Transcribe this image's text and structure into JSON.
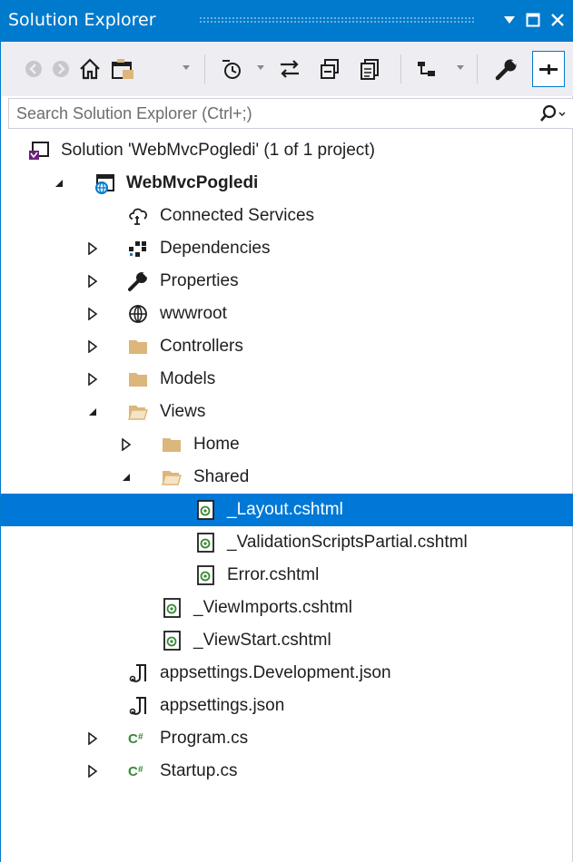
{
  "window": {
    "title": "Solution Explorer"
  },
  "titlebar_buttons": [
    {
      "name": "dropdown-arrow",
      "glyph": "▼"
    },
    {
      "name": "maximize",
      "glyph": "□"
    },
    {
      "name": "close",
      "glyph": "✕"
    }
  ],
  "toolbar": {
    "tools": [
      "back",
      "forward",
      "home",
      "switch-views",
      "pending-changes-filter",
      "sync-with-active-document",
      "collapse-all",
      "show-all-files",
      "preview-selected-items",
      "properties",
      "pin"
    ]
  },
  "search": {
    "placeholder": "Search Solution Explorer (Ctrl+;)"
  },
  "tree": {
    "items": [
      {
        "label": "Solution 'WebMvcPogledi' (1 of 1 project)",
        "icon": "solution-icon",
        "state": "none",
        "selected": false,
        "bold": false
      },
      {
        "label": "WebMvcPogledi",
        "icon": "web-project-icon",
        "state": "expanded",
        "selected": false,
        "bold": true
      },
      {
        "label": "Connected Services",
        "icon": "connected-services-icon",
        "state": "none",
        "selected": false,
        "bold": false
      },
      {
        "label": "Dependencies",
        "icon": "dependencies-icon",
        "state": "collapsed",
        "selected": false,
        "bold": false
      },
      {
        "label": "Properties",
        "icon": "wrench-icon",
        "state": "collapsed",
        "selected": false,
        "bold": false
      },
      {
        "label": "wwwroot",
        "icon": "globe-icon",
        "state": "collapsed",
        "selected": false,
        "bold": false
      },
      {
        "label": "Controllers",
        "icon": "folder-icon",
        "state": "collapsed",
        "selected": false,
        "bold": false
      },
      {
        "label": "Models",
        "icon": "folder-icon",
        "state": "collapsed",
        "selected": false,
        "bold": false
      },
      {
        "label": "Views",
        "icon": "folder-open-icon",
        "state": "expanded",
        "selected": false,
        "bold": false
      },
      {
        "label": "Home",
        "icon": "folder-icon",
        "state": "collapsed",
        "selected": false,
        "bold": false
      },
      {
        "label": "Shared",
        "icon": "folder-open-icon",
        "state": "expanded",
        "selected": false,
        "bold": false
      },
      {
        "label": "_Layout.cshtml",
        "icon": "razor-file-icon",
        "state": "none",
        "selected": true,
        "bold": false
      },
      {
        "label": "_ValidationScriptsPartial.cshtml",
        "icon": "razor-file-icon",
        "state": "none",
        "selected": false,
        "bold": false
      },
      {
        "label": "Error.cshtml",
        "icon": "razor-file-icon",
        "state": "none",
        "selected": false,
        "bold": false
      },
      {
        "label": "_ViewImports.cshtml",
        "icon": "razor-file-icon",
        "state": "none",
        "selected": false,
        "bold": false
      },
      {
        "label": "_ViewStart.cshtml",
        "icon": "razor-file-icon",
        "state": "none",
        "selected": false,
        "bold": false
      },
      {
        "label": "appsettings.Development.json",
        "icon": "json-file-icon",
        "state": "none",
        "selected": false,
        "bold": false
      },
      {
        "label": "appsettings.json",
        "icon": "json-file-icon",
        "state": "none",
        "selected": false,
        "bold": false
      },
      {
        "label": "Program.cs",
        "icon": "csharp-file-icon",
        "state": "collapsed",
        "selected": false,
        "bold": false
      },
      {
        "label": "Startup.cs",
        "icon": "csharp-file-icon",
        "state": "collapsed",
        "selected": false,
        "bold": false
      }
    ]
  },
  "colors": {
    "accent": "#007acc",
    "selection": "#0078d7",
    "folder": "#dcb67a",
    "csharp": "#388a34",
    "solution": "#68217a"
  }
}
